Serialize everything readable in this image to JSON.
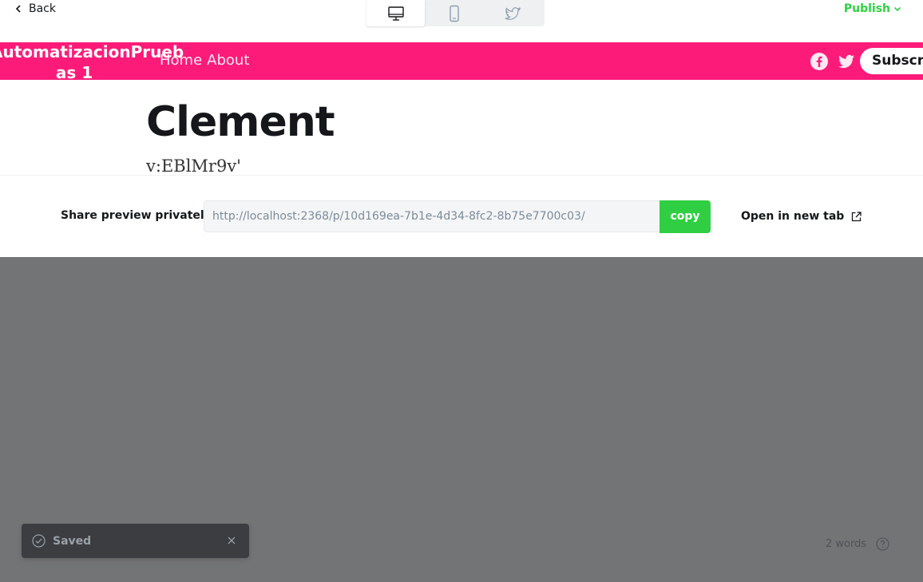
{
  "toolbar": {
    "back_label": "Back",
    "publish_label": "Publish",
    "devices": [
      "desktop",
      "mobile",
      "twitter"
    ],
    "active_device": "desktop"
  },
  "site": {
    "title_line1": "AutomatizacionPrueb",
    "title_line2": "as 1",
    "nav": [
      "Home",
      "About"
    ],
    "subscribe_label": "Subscribe",
    "brand_color": "#fd1b79"
  },
  "post": {
    "title": "Clement",
    "excerpt": "v:EBlMr9v'"
  },
  "share": {
    "label": "Share preview privately",
    "url": "http://localhost:2368/p/10d169ea-7b1e-4d34-8fc2-8b75e7700c03/",
    "copy_label": "copy",
    "open_label": "Open in new tab"
  },
  "toast": {
    "message": "Saved"
  },
  "footer": {
    "word_count": "2 words"
  },
  "colors": {
    "accent_green": "#30cf43",
    "overlay": "#737475"
  }
}
